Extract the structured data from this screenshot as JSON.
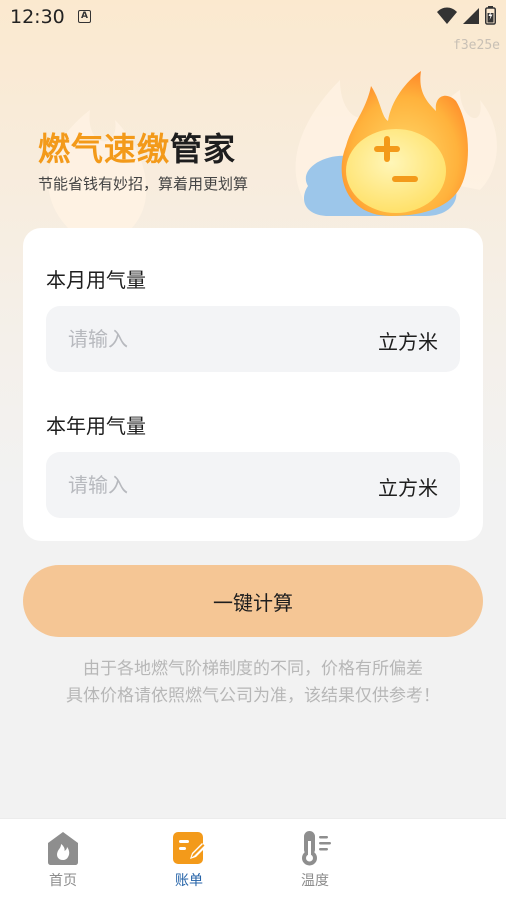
{
  "status_bar": {
    "time": "12:30",
    "notification_letter": "A"
  },
  "build_code": "f3e25e",
  "brand": {
    "title_part1": "燃气速缴",
    "title_part2": "管家",
    "subtitle": "节能省钱有妙招，算着用更划算",
    "colors": {
      "accent": "#f39a1a"
    }
  },
  "form": {
    "monthly": {
      "label": "本月用气量",
      "placeholder": "请输入",
      "value": "",
      "unit": "立方米"
    },
    "yearly": {
      "label": "本年用气量",
      "placeholder": "请输入",
      "value": "",
      "unit": "立方米"
    },
    "submit_label": "一键计算",
    "submit_color": "#f5c695"
  },
  "notice": {
    "line1": "由于各地燃气阶梯制度的不同，价格有所偏差",
    "line2": "具体价格请依照燃气公司为准，该结果仅供参考！"
  },
  "tabbar": {
    "active_color": "#2563a8",
    "items": [
      {
        "label": "首页",
        "icon": "flame-home-icon",
        "active": false
      },
      {
        "label": "账单",
        "icon": "bill-edit-icon",
        "active": true
      },
      {
        "label": "温度",
        "icon": "thermometer-icon",
        "active": false
      }
    ]
  }
}
